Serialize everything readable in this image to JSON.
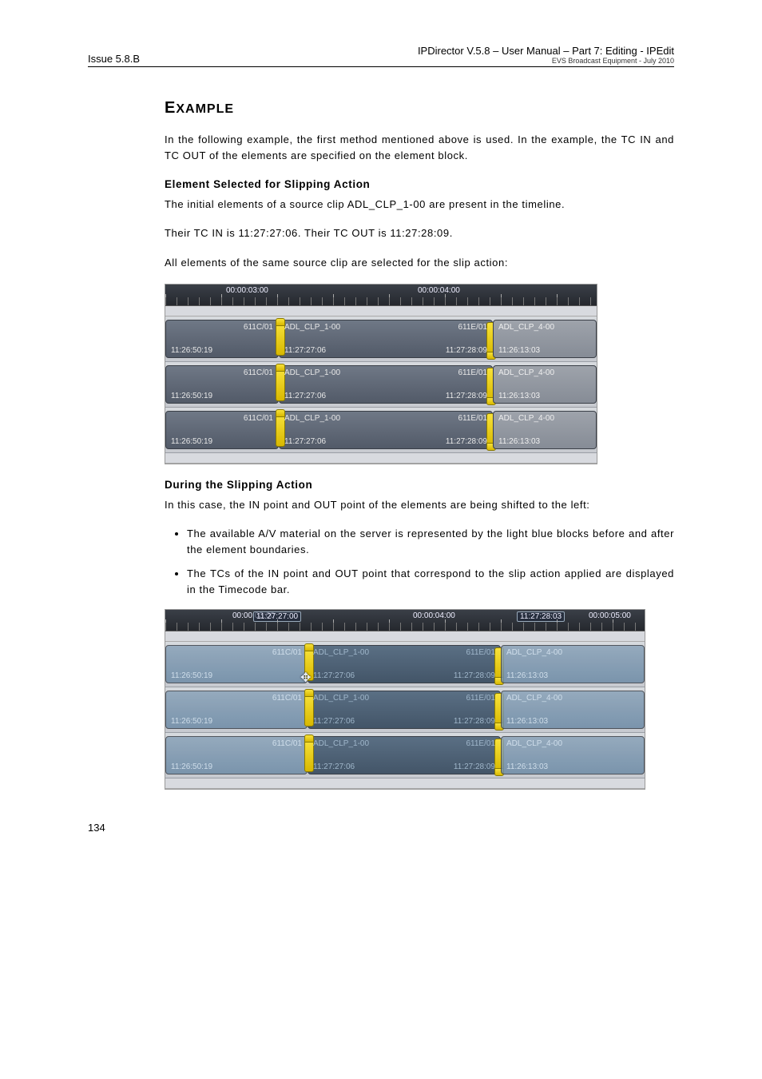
{
  "header": {
    "left": "Issue 5.8.B",
    "right_main": "IPDirector V.5.8 – User Manual – Part 7: Editing - IPEdit",
    "right_sub": "EVS Broadcast Equipment -   July 2010"
  },
  "heading": {
    "first": "E",
    "rest": "XAMPLE"
  },
  "intro": "In the following example, the first method mentioned above is used. In the example, the TC IN and TC OUT of the elements are specified on the element block.",
  "sec1": {
    "title": "Element Selected for Slipping Action",
    "p1": "The initial elements of a source clip ADL_CLP_1-00 are present in the timeline.",
    "p2": "Their TC IN is 11:27:27:06. Their TC OUT is 11:27:28:09.",
    "p3": "All elements of the same source clip are selected for the slip action:"
  },
  "fig1": {
    "ruler": {
      "tc1": "00:00:03:00",
      "tc2": "00:00:04:00"
    },
    "rows": [
      {
        "left": {
          "id": "611C/01",
          "name": "ADL_CLP_1-00",
          "tc_left": "11:26:50:19",
          "tc_right": "11:27:27:06"
        },
        "right": {
          "id": "611E/01",
          "name": "ADL_CLP_4-00",
          "tc_left": "11:27:28:09",
          "tc_right": "11:26:13:03"
        }
      },
      {
        "left": {
          "id": "611C/01",
          "name": "ADL_CLP_1-00",
          "tc_left": "11:26:50:19",
          "tc_right": "11:27:27:06"
        },
        "right": {
          "id": "611E/01",
          "name": "ADL_CLP_4-00",
          "tc_left": "11:27:28:09",
          "tc_right": "11:26:13:03"
        }
      },
      {
        "left": {
          "id": "611C/01",
          "name": "ADL_CLP_1-00",
          "tc_left": "11:26:50:19",
          "tc_right": "11:27:27:06"
        },
        "right": {
          "id": "611E/01",
          "name": "ADL_CLP_4-00",
          "tc_left": "11:27:28:09",
          "tc_right": "11:26:13:03"
        }
      }
    ]
  },
  "sec2": {
    "title": "During the Slipping Action",
    "p1": "In this case, the IN point and OUT point of the elements are being shifted to the left:",
    "b1": "The available A/V material on the server is represented by the light blue blocks before and after the element boundaries.",
    "b2": "The TCs of the IN point and OUT point that correspond to the slip action applied are displayed in the Timecode bar."
  },
  "fig2": {
    "ruler": {
      "tc0": "00:00:03:00",
      "box1": "11:27:27:00",
      "tc2": "00:00:04:00",
      "box2": "11:27:28:03",
      "tc3": "00:00:05:00"
    },
    "rows": [
      {
        "left": {
          "id": "611C/01",
          "name": "ADL_CLP_1-00",
          "tc_left": "11:26:50:19",
          "tc_right": "11:27:27:06"
        },
        "right": {
          "id": "611E/01",
          "name": "ADL_CLP_4-00",
          "tc_left": "11:27:28:09",
          "tc_right": "11:26:13:03"
        }
      },
      {
        "left": {
          "id": "611C/01",
          "name": "ADL_CLP_1-00",
          "tc_left": "11:26:50:19",
          "tc_right": "11:27:27:06"
        },
        "right": {
          "id": "611E/01",
          "name": "ADL_CLP_4-00",
          "tc_left": "11:27:28:09",
          "tc_right": "11:26:13:03"
        }
      },
      {
        "left": {
          "id": "611C/01",
          "name": "ADL_CLP_1-00",
          "tc_left": "11:26:50:19",
          "tc_right": "11:27:27:06"
        },
        "right": {
          "id": "611E/01",
          "name": "ADL_CLP_4-00",
          "tc_left": "11:27:28:09",
          "tc_right": "11:26:13:03"
        }
      }
    ]
  },
  "page_num": "134"
}
